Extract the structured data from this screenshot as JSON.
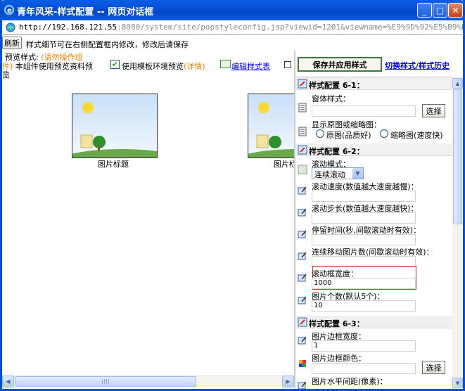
{
  "window": {
    "title": "青年风采-样式配置  -- 网页对话框",
    "address": {
      "host": "http://192.168.121.55",
      "path": ":8080/system/site/popstyleconfig.jsp?viewid=1201&viewname=%E9%9D%92%E5%B9%B4%E9%A3%8"
    },
    "controls": {
      "minimize": "_",
      "maximize": "□",
      "close": "✕"
    }
  },
  "toolbar": {
    "refresh_label": "刷新",
    "notice": "样式细节可在右侧配置框内修改，修改后请保存"
  },
  "left": {
    "preview_label": "预览样式: ",
    "preview_warn": "(请勿操作组",
    "preview_warn2": "件)",
    "preview_text2": " 本组件使用预览资料预",
    "preview_text3": "览",
    "template_check_label": "使用模板环境预览",
    "template_detail": "(详情)",
    "edit_style_link": "编辑样式表",
    "items": [
      {
        "caption": "图片标题"
      },
      {
        "caption": "图片标"
      }
    ]
  },
  "right": {
    "save_button": "保存并应用样式",
    "switch_link": "切换样式/样式历史",
    "sections": [
      {
        "title": "样式配置 6-1："
      },
      {
        "title": "样式配置 6-2："
      },
      {
        "title": "样式配置 6-3："
      }
    ],
    "fields": {
      "window_style": {
        "label": "窗体样式：",
        "value": "",
        "button": "选择"
      },
      "show_image": {
        "label": "显示原图或缩略图：",
        "option1": "原图(品质好)",
        "option2": "缩略图(速度快)"
      },
      "scroll_mode": {
        "label": "滚动模式：",
        "value": "连续滚动"
      },
      "scroll_speed": {
        "label": "滚动速度(数值越大速度越慢)：",
        "value": ""
      },
      "scroll_step": {
        "label": "滚动步长(数值越大速度越快)：",
        "value": ""
      },
      "pause_time": {
        "label": "停留时间(秒,间歇滚动时有效)：",
        "value": ""
      },
      "continuous_count": {
        "label": "连续移动图片数(间歇滚动时有效)：",
        "value": ""
      },
      "frame_width": {
        "label": "滚动框宽度：",
        "value": "1000"
      },
      "image_count": {
        "label": "图片个数(默认5个)：",
        "value": "10"
      },
      "border_width": {
        "label": "图片边框宽度：",
        "value": "1"
      },
      "border_color": {
        "label": "图片边框颜色：",
        "value": "",
        "button": "选择"
      },
      "h_spacing": {
        "label": "图片水平间距(像素)：",
        "value": ""
      }
    }
  }
}
